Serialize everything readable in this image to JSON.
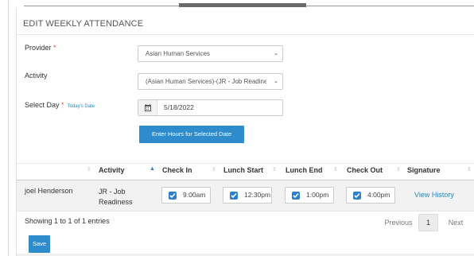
{
  "form": {
    "title": "EDIT WEEKLY ATTENDANCE",
    "provider_label": "Provider",
    "required_mark": "*",
    "provider_value": "Asian Human Services",
    "activity_label": "Activity",
    "activity_value": "(Asian Human Services)-(JR - Job Readiness)",
    "select_day_label": "Select Day",
    "today_link": "Today's Date",
    "date_value": "5/18/2022",
    "enter_hours_button": "Enter Hours for Selected Date"
  },
  "table": {
    "columns": [
      "",
      "Activity",
      "Check In",
      "Lunch Start",
      "Lunch End",
      "Check Out",
      "Signature"
    ],
    "rows": [
      {
        "name": "joel Henderson",
        "activity": "JR - Job Readiness",
        "check_in": "9:00am",
        "lunch_start": "12:30pm",
        "lunch_end": "1:00pm",
        "check_out": "4:00pm",
        "signature_link": "View History"
      }
    ]
  },
  "footer": {
    "showing": "Showing 1 to 1 of 1 entries",
    "previous": "Previous",
    "page": "1",
    "next": "Next",
    "save_button": "Save"
  },
  "colors": {
    "primary_button": "#2e8ccc",
    "link": "#2a8ac2",
    "required": "#d9534f",
    "checkbox": "#2e7fd1"
  }
}
